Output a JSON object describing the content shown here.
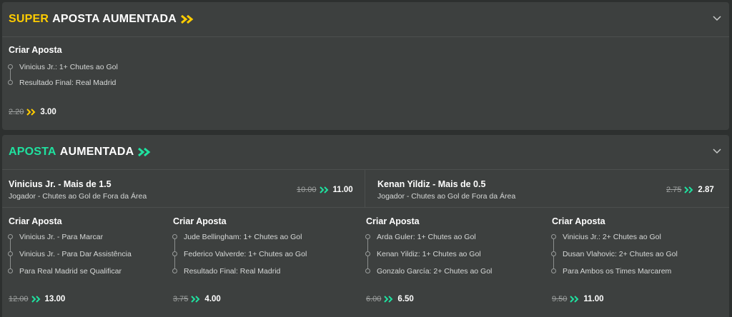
{
  "colors": {
    "accent_yellow": "#ffcc00",
    "accent_green": "#1fe19f",
    "panel_bg": "#3d403f",
    "page_bg": "#2d302f"
  },
  "super_panel": {
    "title_highlight": "SUPER",
    "title_rest": "APOSTA AUMENTADA",
    "title_icon": "double-chevron-right-icon",
    "collapse_icon": "chevron-down-icon",
    "bet": {
      "heading": "Criar Aposta",
      "selections": [
        "Vinicius Jr.: 1+ Chutes ao Gol",
        "Resultado Final: Real Madrid"
      ],
      "old_odds": "2.20",
      "new_odds": "3.00"
    }
  },
  "aposta_panel": {
    "title_highlight": "APOSTA",
    "title_rest": "AUMENTADA",
    "title_icon": "double-chevron-right-icon",
    "collapse_icon": "chevron-down-icon",
    "featured": [
      {
        "title": "Vinicius Jr. - Mais de 1.5",
        "subtitle": "Jogador - Chutes ao Gol de Fora da Área",
        "old_odds": "10.00",
        "new_odds": "11.00"
      },
      {
        "title": "Kenan Yildiz - Mais de 0.5",
        "subtitle": "Jogador - Chutes ao Gol de Fora da Área",
        "old_odds": "2.75",
        "new_odds": "2.87"
      }
    ],
    "bets": [
      {
        "heading": "Criar Aposta",
        "selections": [
          "Vinicius Jr. - Para Marcar",
          "Vinicius Jr. - Para Dar Assistência",
          "Para Real Madrid se Qualificar"
        ],
        "old_odds": "12.00",
        "new_odds": "13.00"
      },
      {
        "heading": "Criar Aposta",
        "selections": [
          "Jude Bellingham: 1+ Chutes ao Gol",
          "Federico Valverde: 1+ Chutes ao Gol",
          "Resultado Final: Real Madrid"
        ],
        "old_odds": "3.75",
        "new_odds": "4.00"
      },
      {
        "heading": "Criar Aposta",
        "selections": [
          "Arda Guler: 1+ Chutes ao Gol",
          "Kenan Yildiz: 1+ Chutes ao Gol",
          "Gonzalo García: 2+ Chutes ao Gol"
        ],
        "old_odds": "6.00",
        "new_odds": "6.50"
      },
      {
        "heading": "Criar Aposta",
        "selections": [
          "Vinicius Jr.: 2+ Chutes ao Gol",
          "Dusan Vlahovic: 2+ Chutes ao Gol",
          "Para Ambos os Times Marcarem"
        ],
        "old_odds": "9.50",
        "new_odds": "11.00"
      }
    ]
  }
}
